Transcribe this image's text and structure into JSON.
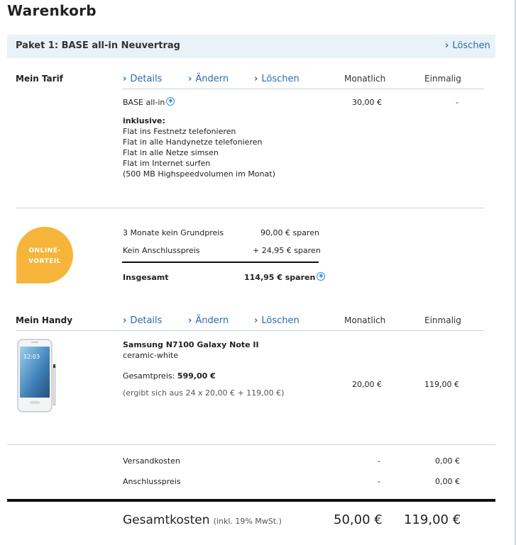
{
  "page": {
    "title": "Warenkorb"
  },
  "paket": {
    "title": "Paket 1: BASE all-in Neuvertrag",
    "delete_label": "Löschen"
  },
  "tarif": {
    "heading": "Mein Tarif",
    "details": "Details",
    "change": "Ändern",
    "delete": "Löschen",
    "col_monthly": "Monatlich",
    "col_once": "Einmalig",
    "name": "BASE all-in",
    "monthly": "30,00 €",
    "once": "-",
    "inklusive_label": "inklusive:",
    "features": [
      "Flat ins Festnetz telefonieren",
      "Flat in alle Handynetze telefonieren",
      "Flat in alle Netze simsen",
      "Flat im Internet surfen",
      "(500 MB Highspeedvolumen im Monat)"
    ]
  },
  "online": {
    "badge_line1": "ONLINE-",
    "badge_line2": "VORTEIL",
    "rows": [
      {
        "label": "3 Monate kein Grundpreis",
        "value": "90,00 € sparen"
      },
      {
        "label": "Kein Anschlusspreis",
        "value": "+ 24,95 € sparen"
      }
    ],
    "total_label": "Insgesamt",
    "total_value": "114,95 € sparen"
  },
  "handy": {
    "heading": "Mein Handy",
    "details": "Details",
    "change": "Ändern",
    "delete": "Löschen",
    "col_monthly": "Monatlich",
    "col_once": "Einmalig",
    "name": "Samsung N7100 Galaxy Note II",
    "color": "ceramic-white",
    "price_label": "Gesamtpreis:",
    "price_value": "599,00 €",
    "price_note": "(ergibt sich aus 24 x 20,00 € + 119,00 €)",
    "monthly": "20,00 €",
    "once": "119,00 €",
    "screen_time": "12:03"
  },
  "extras": [
    {
      "label": "Versandkosten",
      "monthly": "-",
      "once": "0,00 €"
    },
    {
      "label": "Anschlusspreis",
      "monthly": "-",
      "once": "0,00 €"
    }
  ],
  "total": {
    "label": "Gesamtkosten",
    "note": "(inkl. 19% MwSt.)",
    "monthly": "50,00 €",
    "once": "119,00 €"
  },
  "colors": {
    "accent": "#2b6aa8",
    "badge": "#f6b53a",
    "bar": "#e8f2f7"
  }
}
